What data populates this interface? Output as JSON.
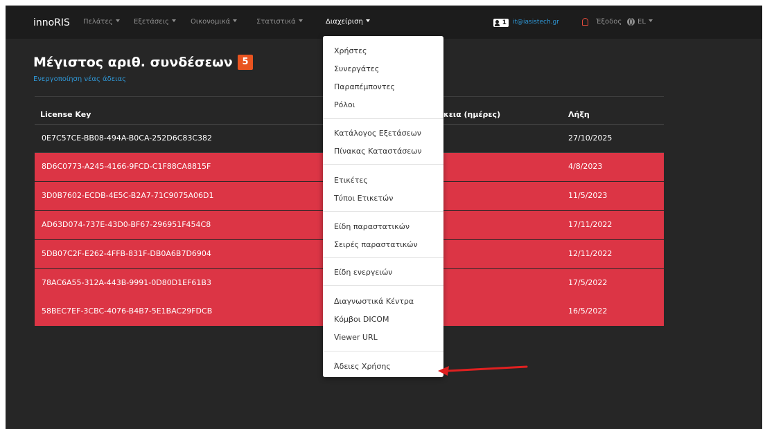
{
  "navbar": {
    "brand": "innoRIS",
    "menus": [
      "Πελάτες",
      "Εξετάσεις",
      "Οικονομικά",
      "Στατιστικά",
      "Διαχείριση"
    ],
    "user_count": "1",
    "email": "it@iasistech.gr",
    "logout": "Έξοδος",
    "language": "EL"
  },
  "page": {
    "title": "Μέγιστος αριθ. συνδέσεων",
    "max_connections": "5",
    "activate_link": "Ενεργοποίηση νέας άδειας"
  },
  "table": {
    "columns": [
      "License Key",
      "ρκεια (ημέρες)",
      "Λήξη"
    ],
    "rows": [
      {
        "key": "0E7C57CE-BB08-494A-B0CA-252D6C83C382",
        "expiry": "27/10/2025",
        "status": "valid"
      },
      {
        "key": "8D6C0773-A245-4166-9FCD-C1F88CA8815F",
        "expiry": "4/8/2023",
        "status": "expired"
      },
      {
        "key": "3D0B7602-ECDB-4E5C-B2A7-71C9075A06D1",
        "expiry": "11/5/2023",
        "status": "expired"
      },
      {
        "key": "AD63D074-737E-43D0-BF67-296951F454C8",
        "expiry": "17/11/2022",
        "status": "expired"
      },
      {
        "key": "5DB07C2F-E262-4FFB-831F-DB0A6B7D6904",
        "expiry": "12/11/2022",
        "status": "expired"
      },
      {
        "key": "78AC6A55-312A-443B-9991-0D80D1EF61B3",
        "expiry": "17/5/2022",
        "status": "expired"
      },
      {
        "key": "58BEC7EF-3CBC-4076-B4B7-5E1BAC29FDCB",
        "expiry": "16/5/2022",
        "status": "expired"
      }
    ]
  },
  "dropdown": {
    "items": [
      "Χρήστες",
      "Συνεργάτες",
      "Παραπέμποντες",
      "Ρόλοι",
      "Κατάλογος Εξετάσεων",
      "Πίνακας Καταστάσεων",
      "Ετικέτες",
      "Τύποι Ετικετών",
      "Είδη παραστατικών",
      "Σειρές παραστατικών",
      "Είδη ενεργειών",
      "Διαγνωστικά Κέντρα",
      "Κόμβοι DICOM",
      "Viewer URL",
      "Άδειες Χρήσης"
    ]
  },
  "colors": {
    "expired_row": "#dc3545",
    "badge": "#e95420",
    "link": "#2f97d6",
    "arrow": "#e02020"
  },
  "icons": [
    "user-icon",
    "bell-icon",
    "globe-icon",
    "caret-down-icon",
    "arrow-annotation-icon"
  ]
}
